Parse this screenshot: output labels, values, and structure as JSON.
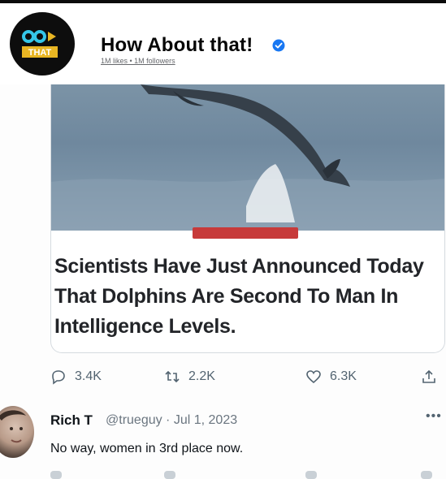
{
  "page": {
    "name": "How About that!",
    "stats": "1M likes • 1M followers",
    "logo_text": "THAT",
    "verified_icon": "verified-badge-icon",
    "accent_color": "#1877f2"
  },
  "post": {
    "headline": "Scientists Have Just Announced Today That Dolphins Are Second To Man In Intelligence Levels.",
    "actions": [
      {
        "icon": "reply-icon",
        "count": "3.4K"
      },
      {
        "icon": "retweet-icon",
        "count": "2.2K"
      },
      {
        "icon": "like-icon",
        "count": "6.3K"
      },
      {
        "icon": "share-icon",
        "count": ""
      }
    ]
  },
  "reply": {
    "name": "Rich T",
    "meta": "@trueguy · Jul 1, 2023",
    "more": "•••",
    "text": "No way, women in 3rd place now."
  }
}
